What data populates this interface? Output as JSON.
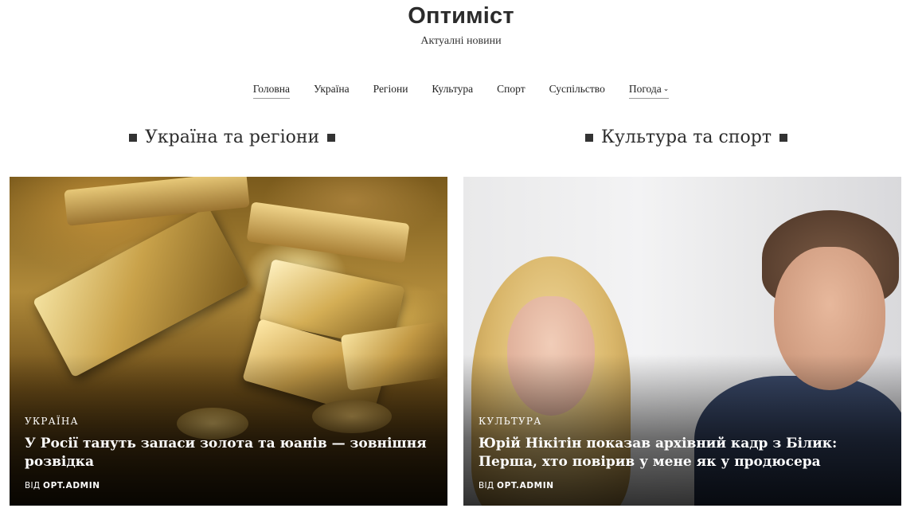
{
  "site": {
    "title": "Оптиміст",
    "tagline": "Актуалні новини"
  },
  "nav": {
    "items": [
      {
        "label": "Головна"
      },
      {
        "label": "Україна"
      },
      {
        "label": "Регіони"
      },
      {
        "label": "Культура"
      },
      {
        "label": "Спорт"
      },
      {
        "label": "Суспільство"
      },
      {
        "label": "Погода",
        "has_dropdown": true
      }
    ],
    "dropdown_icon": "chevron-down-icon"
  },
  "sections": [
    {
      "title": "Україна та регіони",
      "post": {
        "category": "УКРАЇНА",
        "headline": "У Росії тануть запаси золота та юанів — зовнішня розвідка",
        "by_label": "ВІД",
        "author": "OPT.ADMIN",
        "image": "gold-bars-image"
      }
    },
    {
      "title": "Культура та спорт",
      "post": {
        "category": "КУЛЬТУРА",
        "headline": "Юрій Нікітін показав архівний кадр з Білик: Перша, хто повірив у мене як у продюсера",
        "by_label": "ВІД",
        "author": "OPT.ADMIN",
        "image": "people-portrait-image"
      }
    }
  ],
  "colors": {
    "text": "#222222",
    "overlay_text": "#ffffff",
    "background": "#ffffff"
  }
}
